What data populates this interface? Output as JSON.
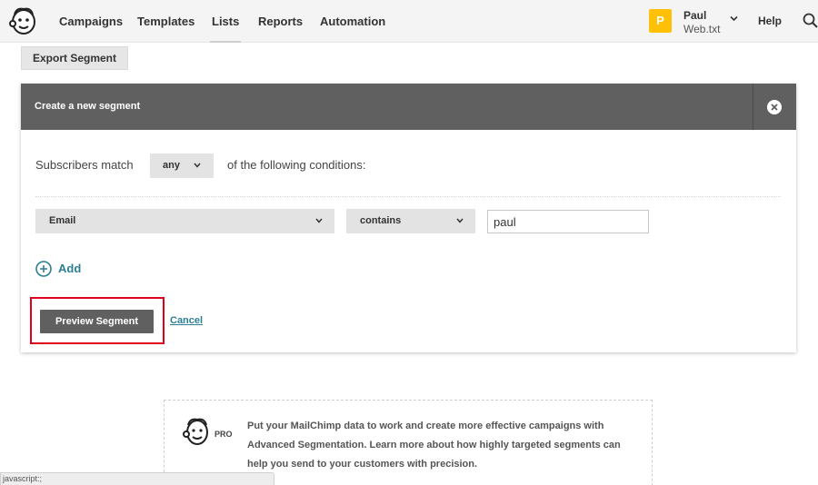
{
  "nav": {
    "items": [
      {
        "label": "Campaigns"
      },
      {
        "label": "Templates"
      },
      {
        "label": "Lists"
      },
      {
        "label": "Reports"
      },
      {
        "label": "Automation"
      }
    ],
    "user": {
      "initial": "P",
      "name": "Paul",
      "account": "Web.txt"
    },
    "help_label": "Help"
  },
  "toolbar": {
    "export_label": "Export Segment"
  },
  "segment": {
    "title": "Create a new segment",
    "match_prefix": "Subscribers match",
    "match_value": "any",
    "match_suffix": "of the following conditions:",
    "condition": {
      "field": "Email",
      "operator": "contains",
      "value": "paul"
    },
    "add_label": "Add",
    "preview_label": "Preview Segment",
    "cancel_label": "Cancel"
  },
  "promo": {
    "badge": "PRO",
    "text": "Put your MailChimp data to work and create more effective campaigns with Advanced Segmentation. Learn more about how highly targeted segments can help you send to your customers with precision."
  },
  "statusbar": {
    "text": "javascript:;"
  },
  "colors": {
    "accent": "#2a7f95",
    "header": "#606060",
    "highlight": "#e0001b",
    "avatar": "#ffc107"
  }
}
